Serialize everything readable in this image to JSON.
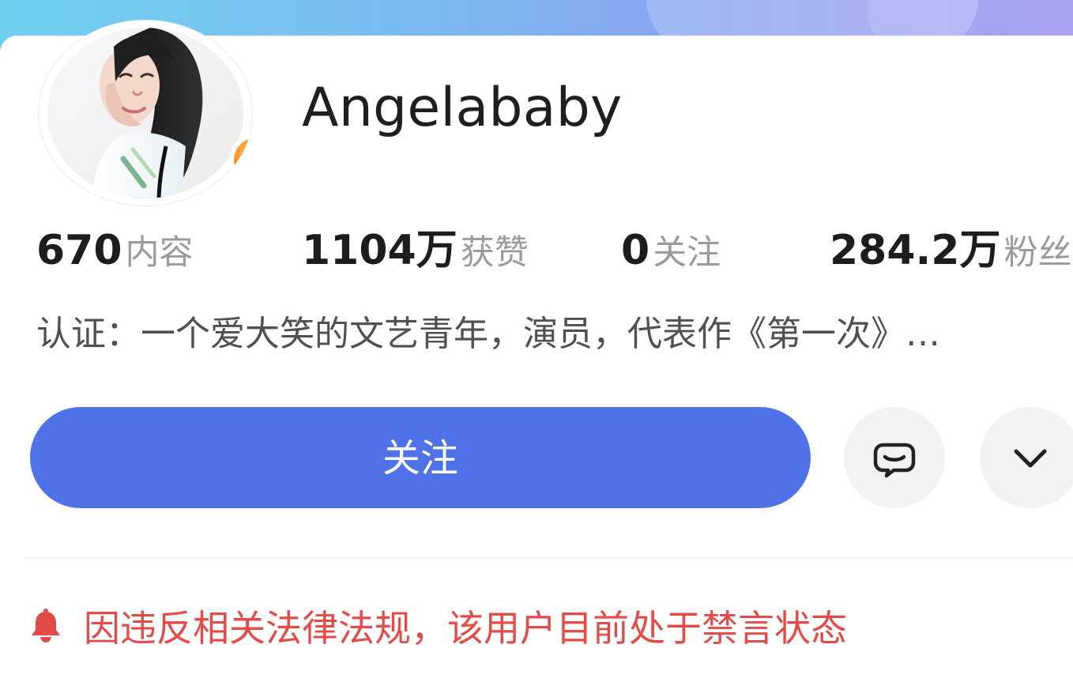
{
  "profile": {
    "username": "Angelababy",
    "verified_badge_text": "V",
    "avatar": "avatar-photo"
  },
  "stats": [
    {
      "value": "670",
      "label": "内容"
    },
    {
      "value": "1104万",
      "label": "获赞"
    },
    {
      "value": "0",
      "label": "关注"
    },
    {
      "value": "284.2万",
      "label": "粉丝"
    }
  ],
  "bio": "认证：一个爱大笑的文艺青年，演员，代表作《第一次》…",
  "actions": {
    "follow_label": "关注",
    "message_icon": "message-icon",
    "more_icon": "chevron-down-icon"
  },
  "notice": {
    "icon": "bell-icon",
    "text": "因违反相关法律法规，该用户目前处于禁言状态"
  },
  "colors": {
    "follow_button": "#5072e9",
    "notice_red": "#e34b48",
    "badge_orange": "#ff8f1f"
  }
}
